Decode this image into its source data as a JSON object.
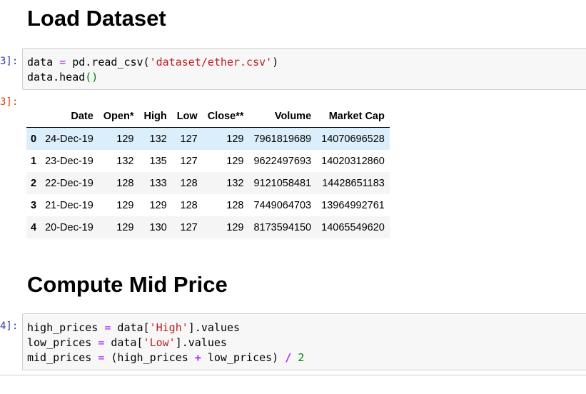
{
  "headings": {
    "load_dataset": "Load Dataset",
    "compute_mid_price": "Compute Mid Price"
  },
  "cell1": {
    "in_prompt": "3]:",
    "out_prompt": "3]:",
    "line1": {
      "a": "data ",
      "eq": "=",
      "b": " pd.read_csv(",
      "str": "'dataset/ether.csv'",
      "c": ")"
    },
    "line2": {
      "a": "data.head",
      "paren": "()"
    }
  },
  "dataframe": {
    "columns": [
      "Date",
      "Open*",
      "High",
      "Low",
      "Close**",
      "Volume",
      "Market Cap"
    ],
    "rows": [
      {
        "index": "0",
        "cells": [
          "24-Dec-19",
          "129",
          "132",
          "127",
          "129",
          "7961819689",
          "14070696528"
        ]
      },
      {
        "index": "1",
        "cells": [
          "23-Dec-19",
          "132",
          "135",
          "127",
          "129",
          "9622497693",
          "14020312860"
        ]
      },
      {
        "index": "2",
        "cells": [
          "22-Dec-19",
          "128",
          "133",
          "128",
          "132",
          "9121058481",
          "14428651183"
        ]
      },
      {
        "index": "3",
        "cells": [
          "21-Dec-19",
          "129",
          "129",
          "128",
          "128",
          "7449064703",
          "13964992761"
        ]
      },
      {
        "index": "4",
        "cells": [
          "20-Dec-19",
          "129",
          "130",
          "127",
          "129",
          "8173594150",
          "14065549620"
        ]
      }
    ]
  },
  "cell2": {
    "in_prompt": "4]:",
    "line1": {
      "a": "high_prices ",
      "eq": "=",
      "b": " data[",
      "str": "'High'",
      "c": "].values"
    },
    "line2": {
      "a": "low_prices ",
      "eq": "=",
      "b": " data[",
      "str": "'Low'",
      "c": "].values"
    },
    "line3": {
      "a": "mid_prices ",
      "eq": "=",
      "b": " (high_prices ",
      "plus": "+",
      "c": " low_prices) ",
      "div": "/",
      "d": " ",
      "num": "2"
    }
  }
}
